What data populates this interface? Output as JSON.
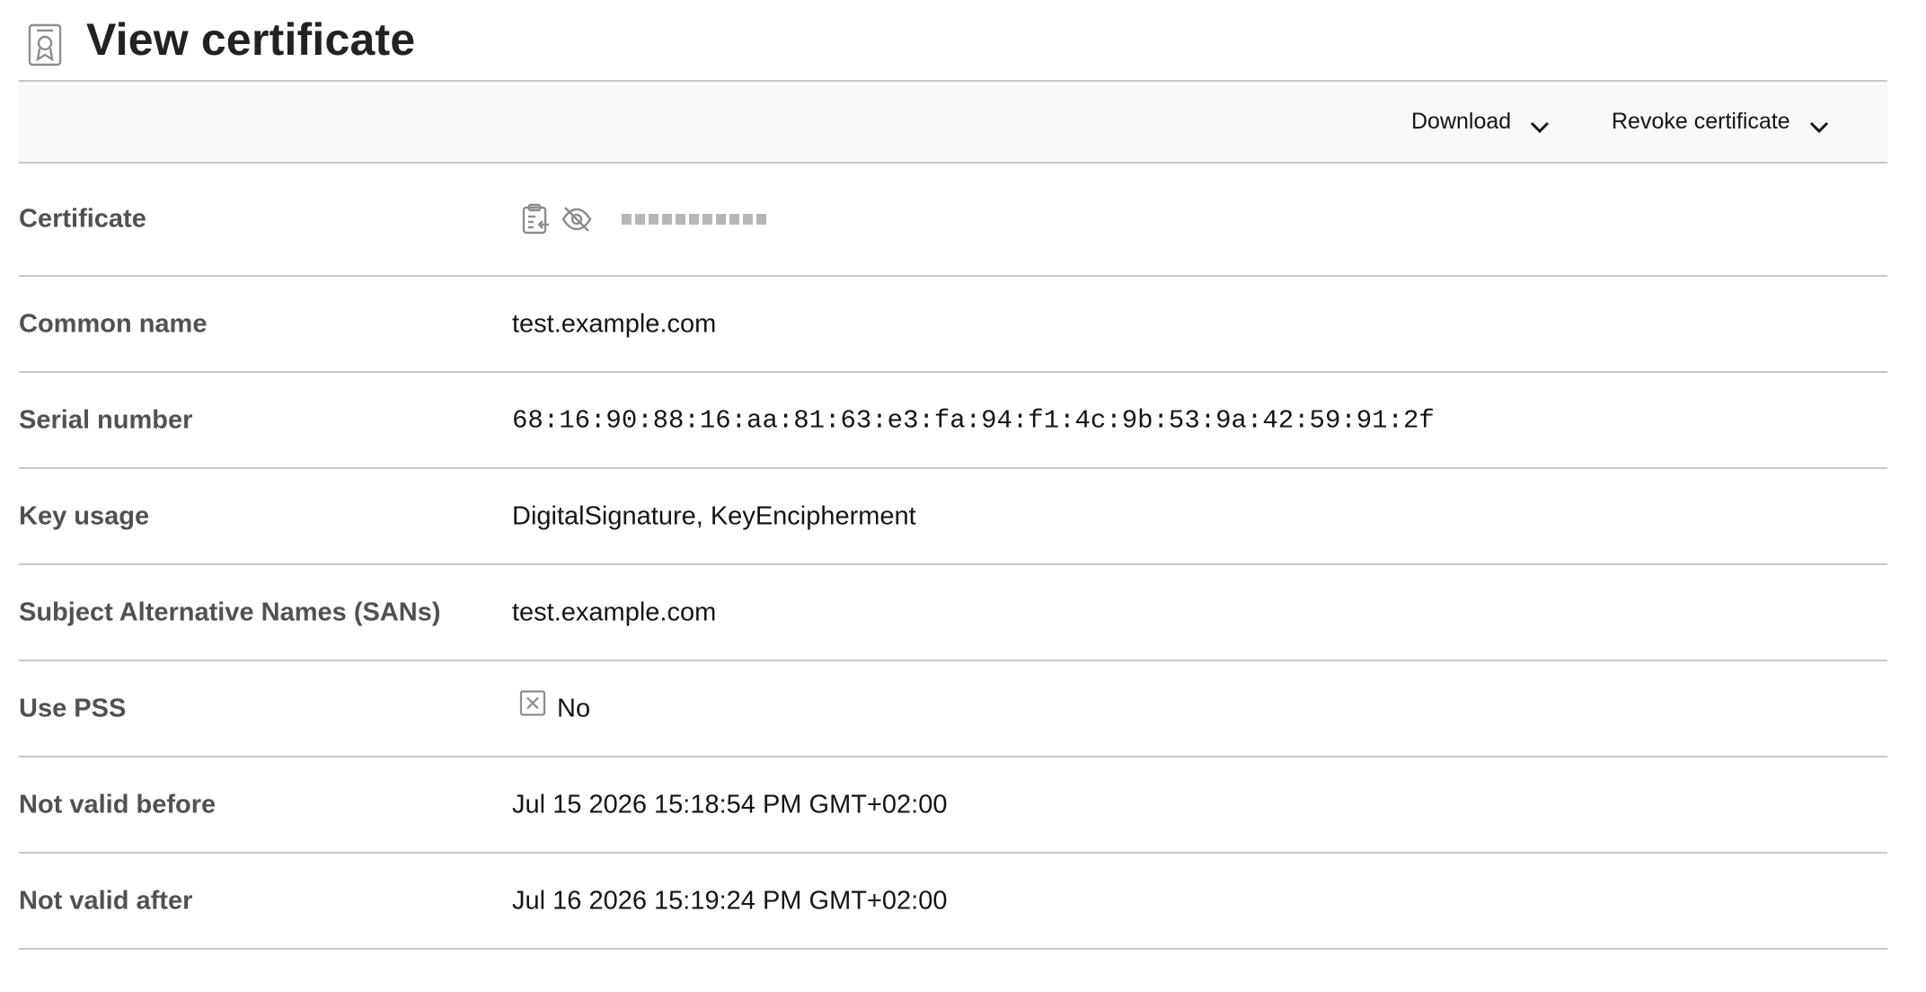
{
  "header": {
    "title": "View certificate",
    "icon": "certificate-icon"
  },
  "toolbar": {
    "download_label": "Download",
    "revoke_label": "Revoke certificate"
  },
  "details": {
    "certificate": {
      "label": "Certificate",
      "masked": true,
      "icons": [
        "copy-to-clipboard-icon",
        "eye-slash-icon"
      ]
    },
    "common_name": {
      "label": "Common name",
      "value": "test.example.com"
    },
    "serial_number": {
      "label": "Serial number",
      "value": "68:16:90:88:16:aa:81:63:e3:fa:94:f1:4c:9b:53:9a:42:59:91:2f"
    },
    "key_usage": {
      "label": "Key usage",
      "value": "DigitalSignature, KeyEncipherment"
    },
    "sans": {
      "label": "Subject Alternative Names (SANs)",
      "value": "test.example.com"
    },
    "use_pss": {
      "label": "Use PSS",
      "value": "No",
      "icon": "x-box-icon"
    },
    "not_valid_before": {
      "label": "Not valid before",
      "value": "Jul 15 2026 15:18:54 PM GMT+02:00"
    },
    "not_valid_after": {
      "label": "Not valid after",
      "value": "Jul 16 2026 15:19:24 PM GMT+02:00"
    }
  },
  "colors": {
    "label": "#4f5255",
    "text": "#151515",
    "divider": "#c7c7cc",
    "toolbar_bg": "#f9f9f9",
    "icon": "#8b8d91"
  }
}
